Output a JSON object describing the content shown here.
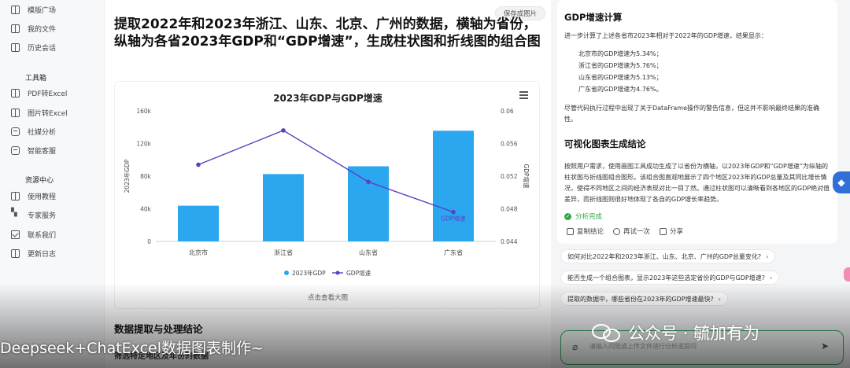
{
  "sidebar": {
    "top_items": [
      {
        "label": "模版广场",
        "icon": "grid-icon"
      },
      {
        "label": "我的文件",
        "icon": "book-icon"
      },
      {
        "label": "历史会话",
        "icon": "chat-icon"
      }
    ],
    "toolbox": {
      "title": "工具箱",
      "items": [
        {
          "label": "PDF转Excel",
          "icon": "book-icon"
        },
        {
          "label": "图片转Excel",
          "icon": "book-icon"
        },
        {
          "label": "社媒分析",
          "icon": "chat-icon"
        },
        {
          "label": "智能客服",
          "icon": "chat-icon"
        }
      ]
    },
    "resources": {
      "title": "资源中心",
      "items": [
        {
          "label": "使用教程",
          "icon": "book-icon"
        },
        {
          "label": "专家服务",
          "icon": "grid-icon"
        },
        {
          "label": "联系我们",
          "icon": "mail-icon"
        },
        {
          "label": "更新日志",
          "icon": "book-icon"
        }
      ]
    }
  },
  "main": {
    "save_button": "保存成图片",
    "title": "提取2022年和2023年浙江、山东、北京、广州的数据，横轴为省份，纵轴为各省2023年GDP和“GDP增速”，生成柱状图和折线图的组合图",
    "view_large": "点击查看大图",
    "section_heading": "数据提取与处理结论",
    "section_sub": "筛选特定地区及年份的数据"
  },
  "chart_data": {
    "type": "bar",
    "title": "2023年GDP与GDP增速",
    "categories": [
      "北京市",
      "浙江省",
      "山东省",
      "广东省"
    ],
    "series": [
      {
        "name": "2023年GDP",
        "type": "bar",
        "axis": "left",
        "color": "#2aa7ef",
        "values": [
          43760,
          82553,
          92069,
          135673
        ]
      },
      {
        "name": "GDP增速",
        "type": "line",
        "axis": "right",
        "color": "#5b3fc4",
        "values": [
          0.0534,
          0.0576,
          0.0513,
          0.0476
        ]
      }
    ],
    "ylabel": "2023年GDP",
    "y2label": "GDP增速",
    "ylim": [
      0,
      160000
    ],
    "y2lim": [
      0.044,
      0.06
    ],
    "yticks": [
      {
        "value": 0,
        "label": "0"
      },
      {
        "value": 40000,
        "label": "40k"
      },
      {
        "value": 80000,
        "label": "80k"
      },
      {
        "value": 120000,
        "label": "120k"
      },
      {
        "value": 160000,
        "label": "160k"
      }
    ],
    "y2ticks": [
      {
        "value": 0.044,
        "label": "0.044"
      },
      {
        "value": 0.048,
        "label": "0.048"
      },
      {
        "value": 0.052,
        "label": "0.052"
      },
      {
        "value": 0.056,
        "label": "0.056"
      },
      {
        "value": 0.06,
        "label": "0.06"
      }
    ],
    "line_end_label": "GDP增速",
    "legend_position": "bottom",
    "grid": false
  },
  "answer": {
    "growth_heading": "GDP增速计算",
    "growth_intro": "进一步计算了上述各省市2023年相对于2022年的GDP增速，结果显示：",
    "growth_items": [
      "北京市的GDP增速为5.34%；",
      "浙江省的GDP增速为5.76%；",
      "山东省的GDP增速为5.13%；",
      "广东省的GDP增速为4.76%。"
    ],
    "warning_note": "尽管代码执行过程中出现了关于DataFrame操作的警告信息，但这并不影响最终结果的准确性。",
    "viz_heading": "可视化图表生成结论",
    "viz_text": "按照用户需求，使用画图工具成功生成了以省份为横轴，以2023年GDP和“GDP增速”为纵轴的柱状图与折线图组合图形。该组合图直观地展示了四个地区2023年的GDP总量及其同比增长情况，使得不同地区之间的经济表现对比一目了然。通过柱状图可以清晰看到各地区的GDP绝对值差异，而折线图则很好地体现了各自的GDP增长率趋势。",
    "status": "分析完成",
    "actions": [
      "复制结论",
      "再试一次",
      "分享"
    ]
  },
  "suggestions": [
    "如何对比2022年和2023年浙江、山东、北京、广州的GDP总量变化?",
    "能否生成一个组合图表，显示2023年这些选定省份的GDP与GDP增速?",
    "提取的数据中，哪些省份在2023年的GDP增速最快?"
  ],
  "input": {
    "placeholder": "请输入问题或上传文件进行分析或提问"
  },
  "overlay": {
    "caption": "Deepseek+ChatExcel数据图表制作~",
    "watermark": "公众号 · 毓加有为"
  },
  "colors": {
    "bar": "#2aa7ef",
    "line": "#5b3fc4",
    "success": "#2aa84a",
    "input_border": "#36a860"
  }
}
